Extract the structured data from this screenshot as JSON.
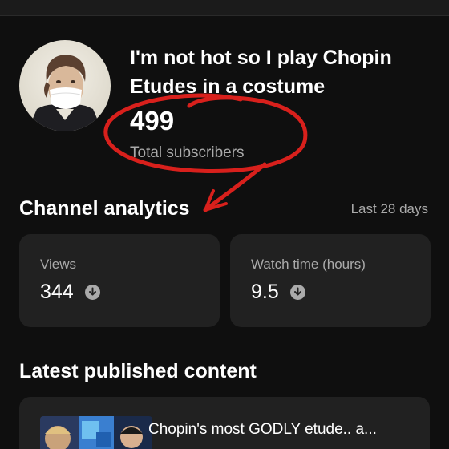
{
  "channel": {
    "name": "I'm not hot so I play Chopin Etudes in a costume",
    "subscriber_count": "499",
    "subscriber_label": "Total subscribers"
  },
  "analytics": {
    "title": "Channel analytics",
    "range": "Last 28 days",
    "cards": [
      {
        "label": "Views",
        "value": "344",
        "trend_icon": "down-arrow-icon"
      },
      {
        "label": "Watch time (hours)",
        "value": "9.5",
        "trend_icon": "down-arrow-icon"
      }
    ]
  },
  "latest": {
    "title": "Latest published content",
    "items": [
      {
        "title": "Chopin's most GODLY etude.. a..."
      }
    ]
  },
  "colors": {
    "background": "#0f0f0f",
    "card": "#212121",
    "annotation_red": "#d8201c",
    "muted_text": "#aaaaaa"
  }
}
